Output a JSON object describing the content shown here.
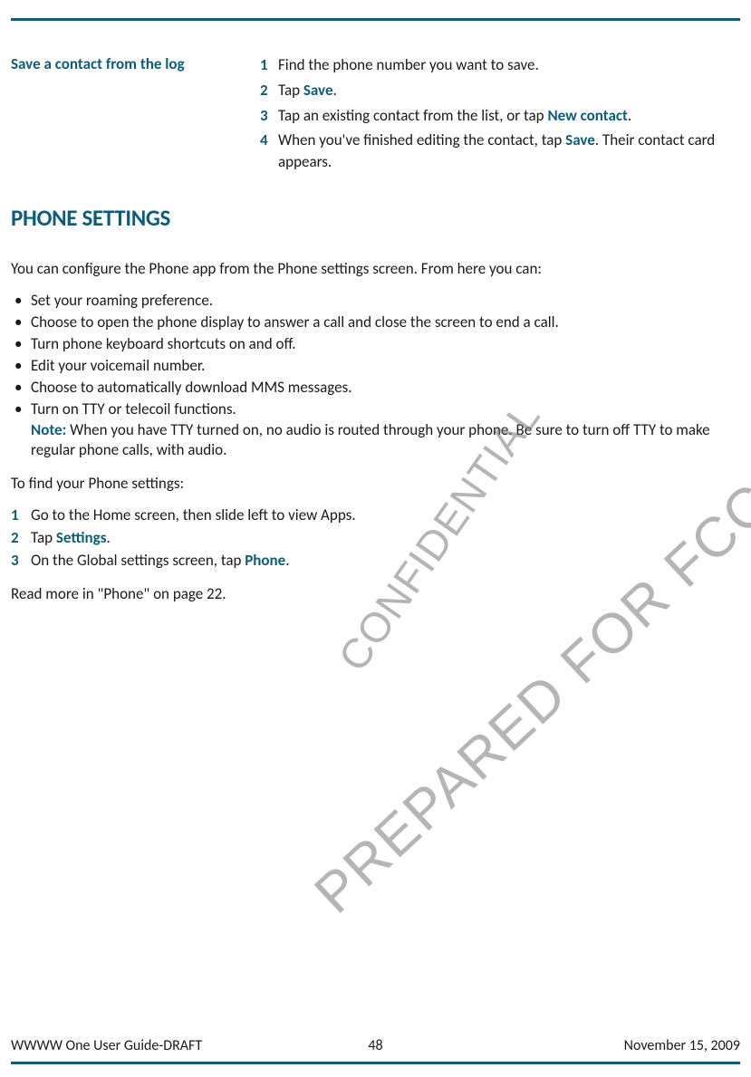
{
  "section1": {
    "sideHeading": "Save a contact from the log",
    "steps": [
      {
        "num": "1",
        "text": "Find the phone number you want to save."
      },
      {
        "num": "2",
        "pre": "Tap ",
        "bold": "Save",
        "post": "."
      },
      {
        "num": "3",
        "pre": "Tap an existing contact from the list, or tap ",
        "bold": "New contact",
        "post": "."
      },
      {
        "num": "4",
        "pre": "When you've finished editing the contact, tap ",
        "bold": "Save",
        "post": ". Their contact card appears."
      }
    ]
  },
  "section2": {
    "heading": "PHONE SETTINGS",
    "intro": "You can configure the Phone app from the Phone settings screen. From here you can:",
    "bullets": [
      {
        "text": "Set your roaming preference."
      },
      {
        "text": "Choose to open the phone display to answer a call and close the screen to end a call."
      },
      {
        "text": "Turn phone keyboard shortcuts on and off."
      },
      {
        "text": "Edit your voicemail number."
      },
      {
        "text": "Choose to automatically download MMS messages."
      },
      {
        "text": "Turn on TTY or telecoil functions.",
        "noteLabel": "Note:",
        "noteText": " When you have TTY turned on, no audio is routed through your phone. Be sure to turn off TTY to make regular phone calls, with audio."
      }
    ],
    "para2": "To find your Phone settings:",
    "numlist": [
      {
        "num": "1",
        "text": "Go to the Home screen, then slide left to view Apps."
      },
      {
        "num": "2",
        "pre": "Tap ",
        "bold": "Settings",
        "post": "."
      },
      {
        "num": "3",
        "pre": "On the Global settings screen, tap ",
        "bold": "Phone",
        "post": "."
      }
    ],
    "closing": "Read more in \"Phone\" on page 22."
  },
  "footer": {
    "left": "WWWW One User Guide-DRAFT",
    "center": "48",
    "right": "November 15, 2009"
  },
  "watermarks": {
    "wm1": "PREPARED FOR FCC CERTIFICATION",
    "wm2": "CONFIDENTIAL"
  }
}
